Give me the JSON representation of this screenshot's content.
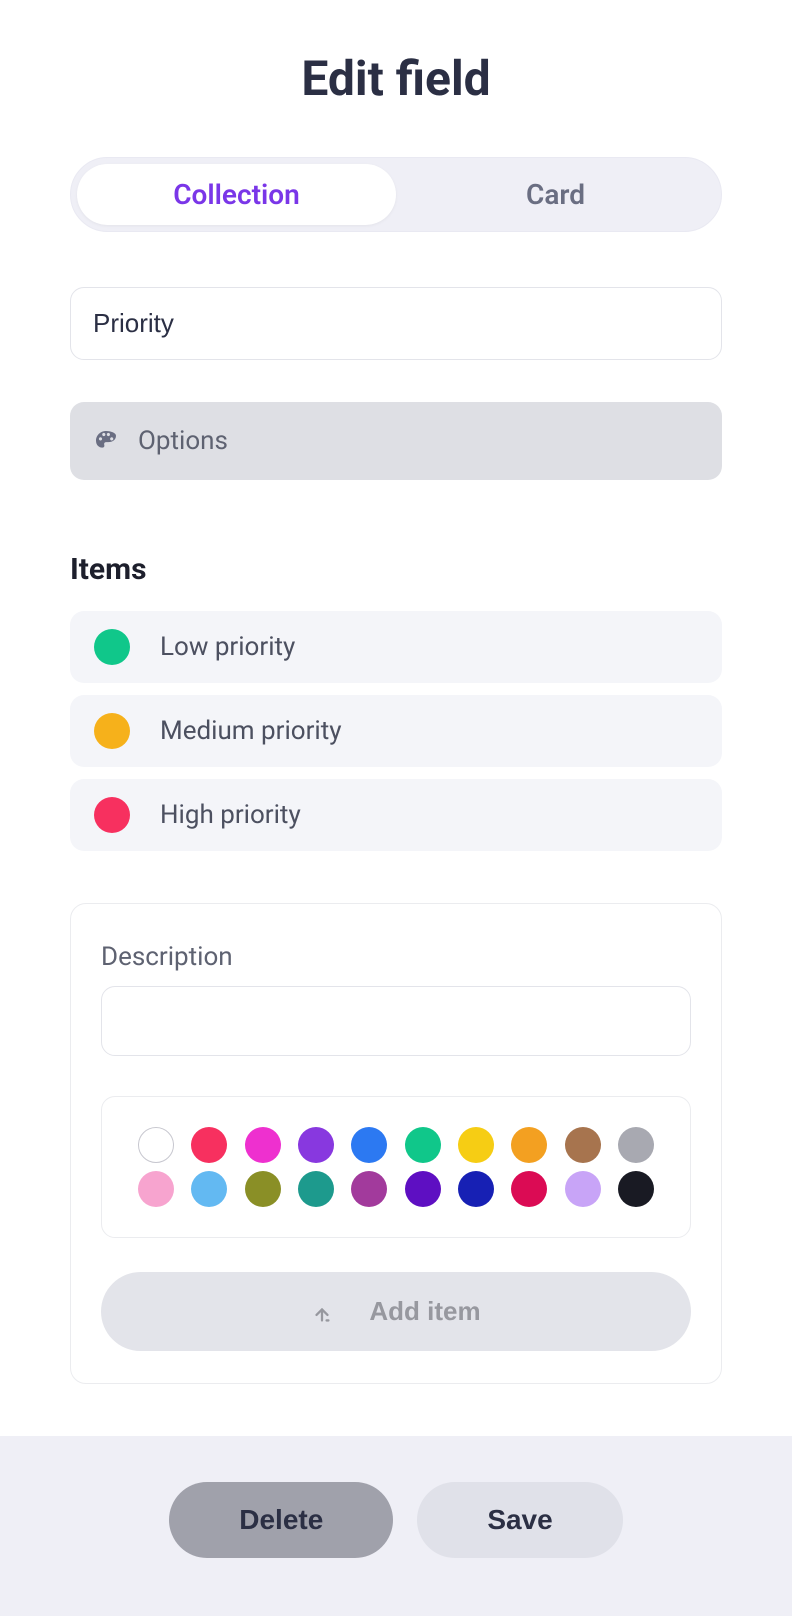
{
  "header": {
    "title": "Edit field"
  },
  "tabs": [
    {
      "label": "Collection",
      "active": true
    },
    {
      "label": "Card",
      "active": false
    }
  ],
  "field_name": {
    "value": "Priority"
  },
  "options_row": {
    "label": "Options"
  },
  "items_section": {
    "heading": "Items"
  },
  "items": [
    {
      "label": "Low priority",
      "color": "#10c78a"
    },
    {
      "label": "Medium priority",
      "color": "#f6b11b"
    },
    {
      "label": "High priority",
      "color": "#f7305f"
    }
  ],
  "new_item": {
    "description_label": "Description",
    "description_value": "",
    "add_item_label": "Add item"
  },
  "palette": {
    "row1": [
      "#ffffff",
      "#f7305f",
      "#ee30cf",
      "#8838df",
      "#2c79f2",
      "#10c78a",
      "#f6cd14",
      "#f3a021",
      "#a7744e",
      "#a8a9b1"
    ],
    "row2": [
      "#f7a4cf",
      "#63b9f2",
      "#8a8f26",
      "#1d9a8d",
      "#a23a9c",
      "#5e0fc2",
      "#1720b4",
      "#db0b54",
      "#c8a4f7",
      "#191a23"
    ]
  },
  "footer": {
    "delete_label": "Delete",
    "save_label": "Save"
  }
}
